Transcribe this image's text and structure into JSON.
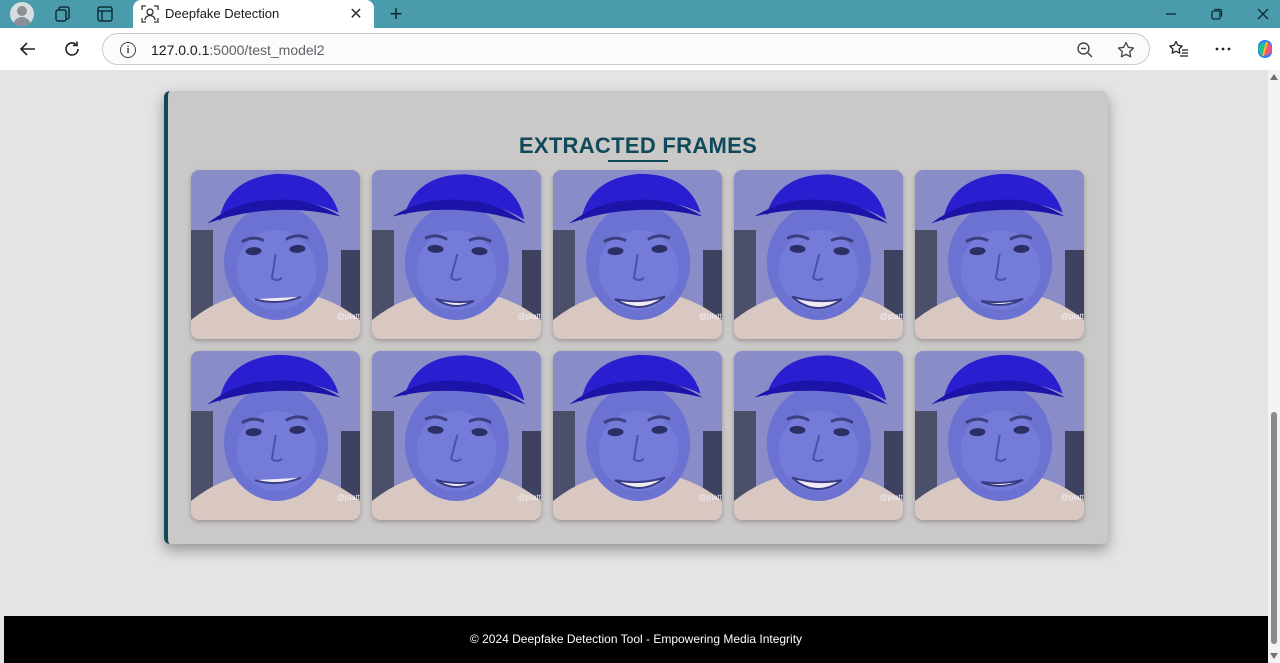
{
  "browser": {
    "tab_title": "Deepfake Detection",
    "url_host": "127.0.0.1",
    "url_path": ":5000/test_model2",
    "icons": [
      "profile-icon",
      "workspaces-icon",
      "tab-actions-icon",
      "tab-favicon",
      "close-icon",
      "plus-icon",
      "minimize-icon",
      "restore-icon",
      "window-close-icon",
      "back-icon",
      "refresh-icon",
      "info-icon",
      "zoom-icon",
      "favorite-star-icon",
      "favorites-icon",
      "more-icon",
      "copilot-icon"
    ]
  },
  "page": {
    "section_title": "EXTRACTED FRAMES",
    "watermark": "@platt",
    "footer_text": "© 2024 Deepfake Detection Tool - Empowering Media Integrity",
    "frame_count": 10,
    "colors": {
      "accent": "#10495a",
      "card_bg": "#cbc8c8",
      "page_bg": "#e4e3e5",
      "footer_bg": "#000000",
      "tab_bar": "#4a9bab",
      "cap": "#2a1fd0",
      "skin": "#6c72d2"
    }
  }
}
